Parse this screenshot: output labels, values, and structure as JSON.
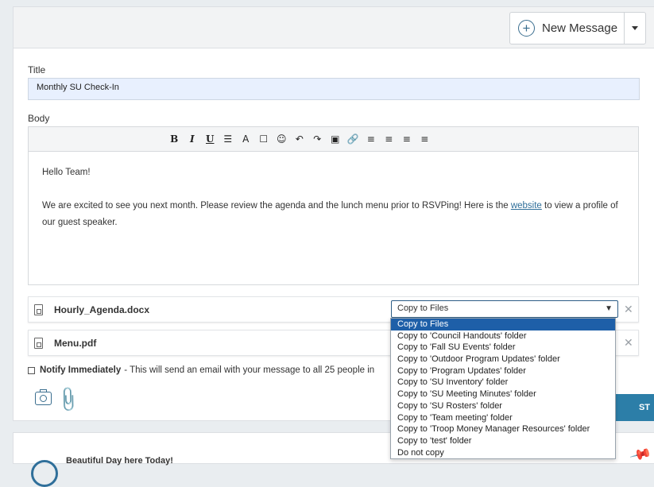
{
  "header": {
    "new_message_label": "New Message"
  },
  "form": {
    "title_label": "Title",
    "title_value": "Monthly SU Check-In",
    "body_label": "Body"
  },
  "toolbar": {
    "buttons": [
      "B",
      "I",
      "U",
      "☰",
      "A",
      "☐",
      "☺",
      "↶",
      "↷",
      "▣",
      "🔗",
      "≡",
      "≡",
      "≡",
      "≡"
    ]
  },
  "body_text": {
    "line1": "Hello Team!",
    "para2_before": "We are excited to see you next month.  Please review the agenda and the lunch menu prior to RSVPing!  Here is the ",
    "link": "website",
    "para2_after": " to view a profile of our guest speaker."
  },
  "attachments": [
    {
      "name": "Hourly_Agenda.docx",
      "select_value": "Copy to Files"
    },
    {
      "name": "Menu.pdf",
      "select_value": ""
    }
  ],
  "notify": {
    "label": "Notify Immediately",
    "text": "- This will send an email with your message to all 25 people in"
  },
  "post_label": "POST",
  "post_visible": "ST",
  "next_post_title": "Beautiful Day here Today!",
  "dropdown_options": [
    "Copy to Files",
    "Copy to 'Council Handouts' folder",
    "Copy to 'Fall SU Events' folder",
    "Copy to 'Outdoor Program Updates' folder",
    "Copy to 'Program Updates' folder",
    "Copy to 'SU Inventory' folder",
    "Copy to 'SU Meeting Minutes' folder",
    "Copy to 'SU Rosters' folder",
    "Copy to 'Team meeting' folder",
    "Copy to 'Troop Money Manager Resources' folder",
    "Copy to 'test' folder",
    "Do not copy"
  ],
  "colors": {
    "accent": "#2c7ea8",
    "selected_option": "#1e5fa8",
    "title_bg": "#e8f0fe"
  }
}
